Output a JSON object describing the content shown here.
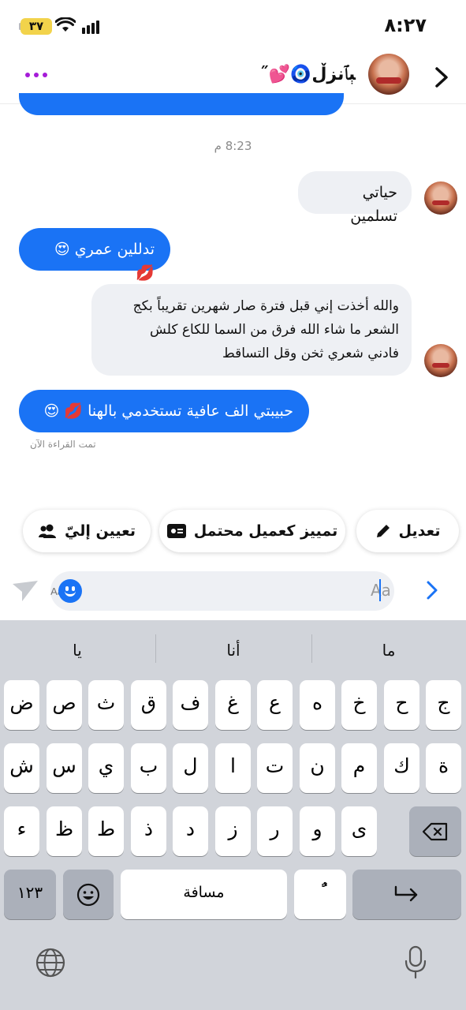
{
  "status_bar": {
    "time": "٨:٢٧",
    "battery": "٣٧"
  },
  "header": {
    "contact_name": "ﯧﭑنزڵ🧿💕˝",
    "more_icon": "more-dots-icon",
    "back_icon": "chevron-right-icon"
  },
  "messages": {
    "timestamp": "8:23 م",
    "m1": "حياتي تسلمين",
    "m2": "تدللين عمري 😍 💋",
    "m3_line1": "والله أخذت إني قبل فترة صار شهرين تقريباً بكج",
    "m3_line2": "الشعر ما شاء الله فرق من السما للكاع كلش",
    "m3_line3": "فادني شعري ثخن وقل التساقط",
    "m4": "حبيبتي الف عافية تستخدمي بالهنا 💋 😍",
    "read_receipt": "تمت القراءة الآن"
  },
  "actions": {
    "edit": "تعديل",
    "mark_customer": "تمييز كعميل محتمل",
    "assign": "تعيين إليّ"
  },
  "composer": {
    "placeholder": "Aa"
  },
  "keyboard": {
    "suggestions": [
      "ما",
      "أنا",
      "يا"
    ],
    "row1": [
      "ج",
      "ح",
      "خ",
      "ه",
      "ع",
      "غ",
      "ف",
      "ق",
      "ث",
      "ص",
      "ض"
    ],
    "row2": [
      "ة",
      "ك",
      "م",
      "ن",
      "ت",
      "ا",
      "ل",
      "ب",
      "ي",
      "س",
      "ش"
    ],
    "row3": [
      "ى",
      "و",
      "ر",
      "ز",
      "د",
      "ذ",
      "ط",
      "ظ",
      "ء"
    ],
    "numbers": "١٢٣",
    "space": "مسافة",
    "tanween": "ًٌ"
  },
  "colors": {
    "accent": "#1a73f5",
    "more_dots": "#a51bd8",
    "keyboard_bg": "#d1d4da"
  }
}
